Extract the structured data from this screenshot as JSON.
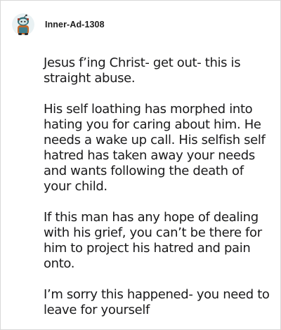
{
  "comment": {
    "author": "Inner-Ad-1308",
    "avatar_icon": "reddit-snoo-avatar-icon",
    "paragraphs": [
      "Jesus f’ing Christ- get out- this is straight abuse.",
      "His self loathing has morphed into hating you for caring about him. He needs a wake up call. His selfish self hatred has taken away your needs and wants following the death of your child.",
      "If this man has any hope of dealing with his grief, you can’t be there for him to project his hatred and pain onto.",
      "I’m sorry this happened- you need to leave for yourself"
    ]
  },
  "colors": {
    "text": "#1a1a1b",
    "border": "#d8d8d8",
    "background": "#ffffff"
  }
}
